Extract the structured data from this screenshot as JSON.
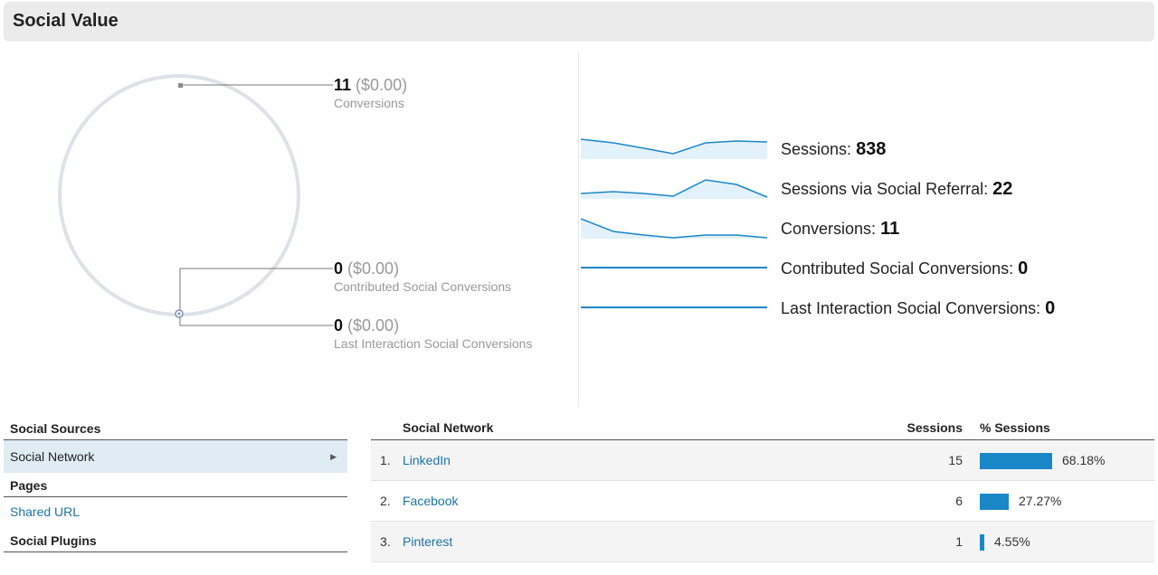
{
  "header": {
    "title": "Social Value"
  },
  "conversions": {
    "total": {
      "value": "11",
      "money": "($0.00)",
      "label": "Conversions"
    },
    "contributed": {
      "value": "0",
      "money": "($0.00)",
      "label": "Contributed Social Conversions"
    },
    "last_interaction": {
      "value": "0",
      "money": "($0.00)",
      "label": "Last Interaction Social Conversions"
    }
  },
  "metrics": [
    {
      "label": "Sessions:",
      "value": "838"
    },
    {
      "label": "Sessions via Social Referral:",
      "value": "22"
    },
    {
      "label": "Conversions:",
      "value": "11"
    },
    {
      "label": "Contributed Social Conversions:",
      "value": "0"
    },
    {
      "label": "Last Interaction Social Conversions:",
      "value": "0"
    }
  ],
  "sidebar": {
    "social_sources": "Social Sources",
    "social_network": "Social Network",
    "pages": "Pages",
    "shared_url": "Shared URL",
    "social_plugins": "Social Plugins"
  },
  "table": {
    "col_network": "Social Network",
    "col_sessions": "Sessions",
    "col_pct": "% Sessions",
    "rows": [
      {
        "idx": "1.",
        "network": "LinkedIn",
        "sessions": "15",
        "pct": "68.18%",
        "share": 0.6818
      },
      {
        "idx": "2.",
        "network": "Facebook",
        "sessions": "6",
        "pct": "27.27%",
        "share": 0.2727
      },
      {
        "idx": "3.",
        "network": "Pinterest",
        "sessions": "1",
        "pct": "4.55%",
        "share": 0.0455
      }
    ]
  },
  "colors": {
    "accent": "#1a87c9",
    "link": "#1a73a8",
    "ring": "#dde2e8"
  }
}
